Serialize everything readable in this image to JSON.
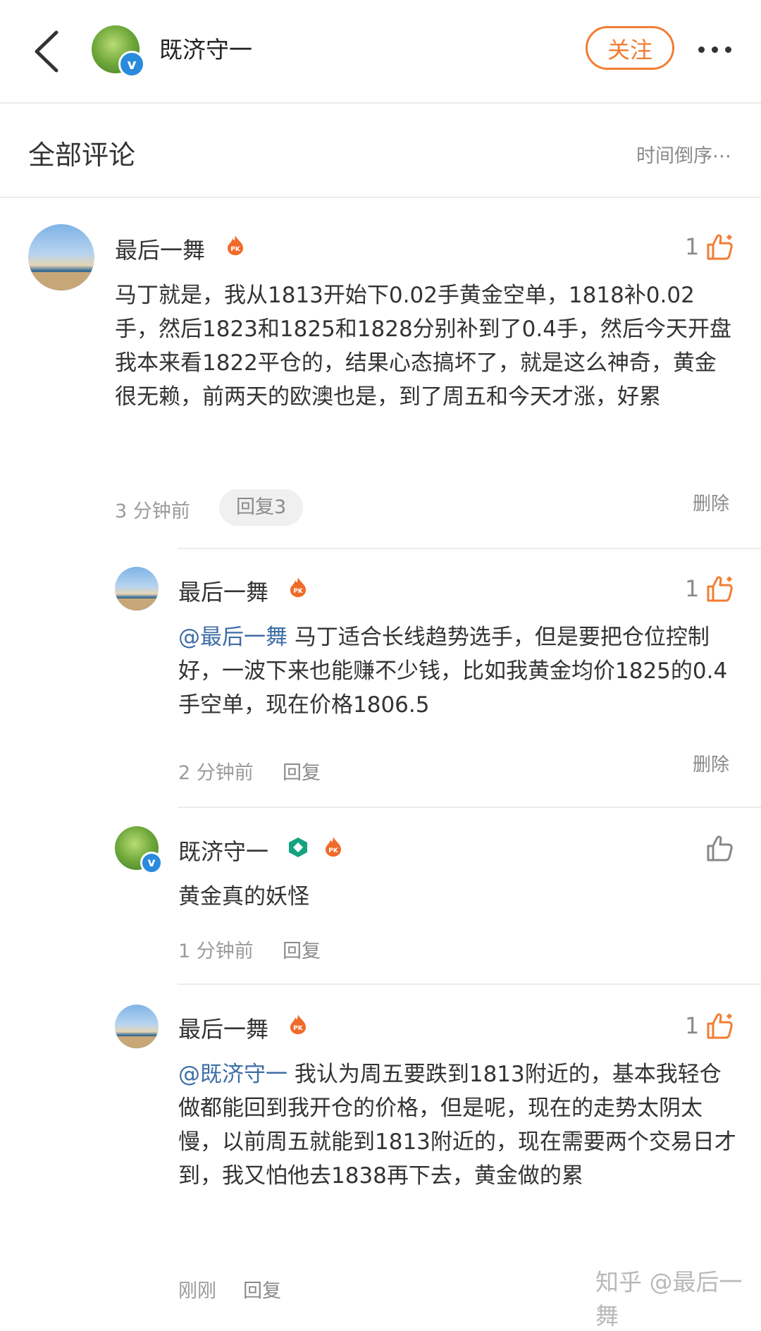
{
  "header": {
    "username": "既济守一",
    "follow_label": "关注"
  },
  "section": {
    "title": "全部评论",
    "sort_label": "时间倒序⋯"
  },
  "main_comment": {
    "author": "最后一舞",
    "likes": "1",
    "text": "马丁就是，我从1813开始下0.02手黄金空单，1818补0.02手，然后1823和1825和1828分别补到了0.4手，然后今天开盘我本来看1822平仓的，结果心态搞坏了，就是这么神奇，黄金很无赖，前两天的欧澳也是，到了周五和今天才涨，好累",
    "time": "3 分钟前",
    "reply_label": "回复3",
    "delete_label": "删除"
  },
  "replies": [
    {
      "author": "最后一舞",
      "likes": "1",
      "mention": "@最后一舞",
      "text": " 马丁适合长线趋势选手，但是要把仓位控制好，一波下来也能赚不少钱，比如我黄金均价1825的0.4手空单，现在价格1806.5",
      "time": "2 分钟前",
      "reply_label": "回复",
      "delete_label": "删除"
    },
    {
      "author": "既济守一",
      "likes": "",
      "mention": "",
      "text": "黄金真的妖怪",
      "time": "1 分钟前",
      "reply_label": "回复"
    },
    {
      "author": "最后一舞",
      "likes": "1",
      "mention": "@既济守一",
      "text": " 我认为周五要跌到1813附近的，基本我轻仓做都能回到我开仓的价格，但是呢，现在的走势太阴太慢，以前周五就能到1813附近的，现在需要两个交易日才到，我又怕他去1838再下去，黄金做的累",
      "time": "刚刚",
      "reply_label": "回复"
    }
  ],
  "watermark": "知乎 @最后一舞",
  "colors": {
    "accent": "#f27d33",
    "mention": "#3e6ea6",
    "verified": "#2a8bdc"
  }
}
